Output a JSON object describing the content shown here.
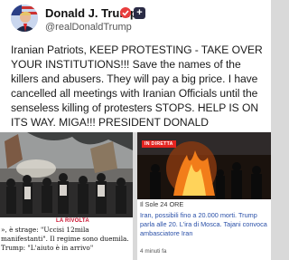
{
  "post": {
    "author_name": "Donald J. Trump",
    "badge_symbol": "+",
    "handle": "@realDonaldTrump",
    "text": "Iranian Patriots, KEEP PROTESTING - TAKE OVER YOUR INSTITUTIONS!!! Save the names of the killers and abusers. They will pay a big price. I have cancelled all meetings with Iranian Officials until the senseless killing of protesters STOPS. HELP IS ON ITS WAY. MIGA!!! PRESIDENT DONALD"
  },
  "cards": {
    "left": {
      "kicker": "LA RIVOLTA",
      "headline": "», è strage: \"Uccisi 12mila manifestanti\". Il regime sono duemila. Trump: \"L'aiuto è in arrivo\""
    },
    "right": {
      "live_tag": "IN DIRETTA",
      "source": "Il Sole 24 ORE",
      "headline": "Iran, possibili fino a 20.000 morti. Trump parla alle 20. L'ira di Mosca. Tajani convoca ambasciatore Iran",
      "read_time": "4 minuti fa"
    }
  },
  "colors": {
    "kicker_red": "#c8102e",
    "live_red": "#e52420",
    "link_blue": "#2a50a8",
    "badge_red": "#e83d3d",
    "badge_dark": "#2a2b45"
  }
}
